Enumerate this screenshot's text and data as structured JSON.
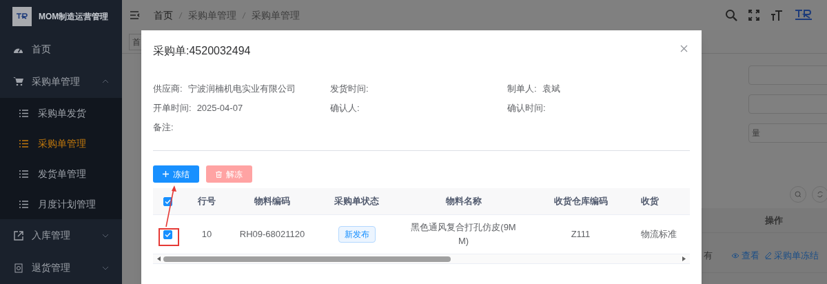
{
  "app": {
    "title": "MOM制造运营管理"
  },
  "sidebar": {
    "items": [
      {
        "label": "首页",
        "kind": "dashboard",
        "expanded": false,
        "selected": false
      },
      {
        "label": "采购单管理",
        "kind": "cart",
        "expanded": true,
        "selected": false,
        "children": [
          {
            "label": "采购单发货",
            "selected": false
          },
          {
            "label": "采购单管理",
            "selected": true
          },
          {
            "label": "发货单管理",
            "selected": false
          },
          {
            "label": "月度计划管理",
            "selected": false
          }
        ]
      },
      {
        "label": "入库管理",
        "kind": "export",
        "expanded": false,
        "selected": false
      },
      {
        "label": "退货管理",
        "kind": "box",
        "expanded": false,
        "selected": false
      }
    ]
  },
  "breadcrumb": [
    "首页",
    "采购单管理",
    "采购单管理"
  ],
  "background": {
    "tab_label": "首",
    "select_placeholder": "量",
    "table_header": "操作",
    "row_cells": [
      {
        "text": "有",
        "actions": [
          "查看",
          "采购单冻结"
        ]
      }
    ]
  },
  "dialog": {
    "title": "采购单:4520032494",
    "fields": [
      {
        "label": "供应商:",
        "value": "宁波润楠机电实业有限公司"
      },
      {
        "label": "发货时间:"
      },
      {
        "label": "制单人:",
        "value": "袁斌"
      },
      {
        "label": "开单时间:",
        "value": "2025-04-07"
      },
      {
        "label": "确认人:"
      },
      {
        "label": "确认时间:"
      },
      {
        "label": "备注:"
      }
    ],
    "buttons": [
      {
        "label": "冻结",
        "kind": "primary",
        "disabled": false
      },
      {
        "label": "解冻",
        "kind": "danger",
        "disabled": true
      }
    ],
    "table": {
      "all_checked": true,
      "columns": [
        "行号",
        "物料编码",
        "采购单状态",
        "物料名称",
        "收货仓库编码",
        "收货"
      ],
      "rows": [
        {
          "checked": true,
          "cells": [
            "10",
            "RH09-68021120",
            "新发布",
            "黑色通风复合打孔仿皮(9MM)",
            "Z111",
            "物流标准"
          ]
        }
      ]
    }
  }
}
